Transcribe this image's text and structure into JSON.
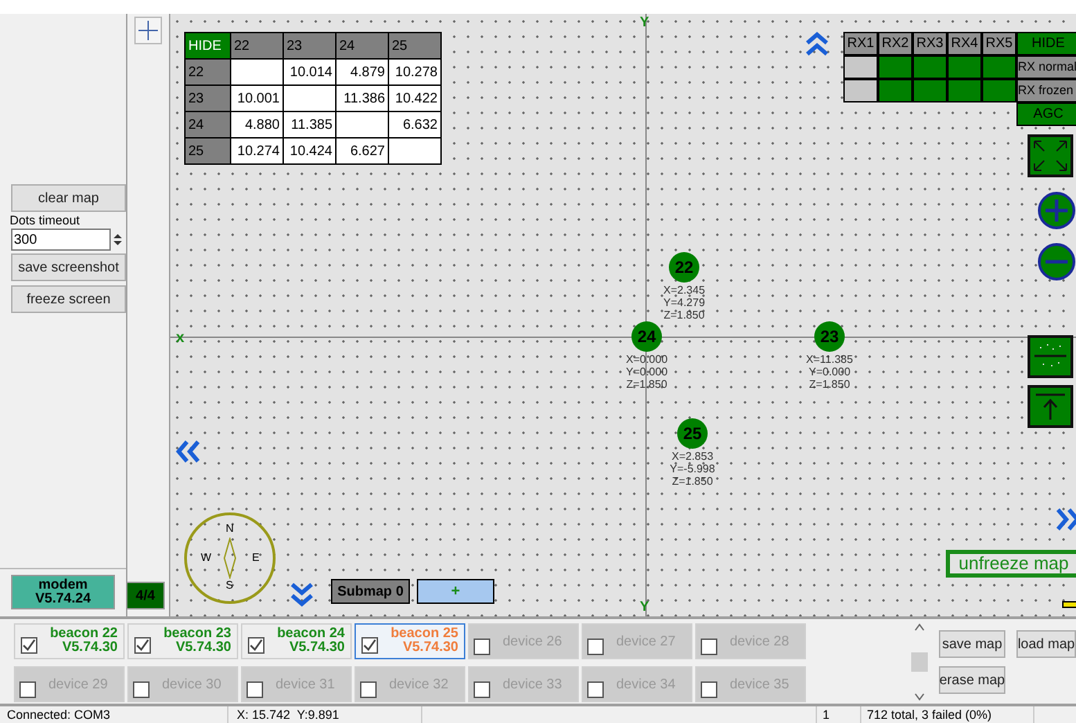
{
  "left_panel": {
    "clear_button": "clear map",
    "dots_timeout": {
      "label": "Dots timeout",
      "value": "300"
    },
    "screenshot_button": "save screenshot",
    "freeze_button": "freeze screen",
    "modem": {
      "name": "modem",
      "version": "V5.74.24"
    },
    "count": "4/4"
  },
  "distance_table": {
    "hide_label": "HIDE",
    "columns": [
      "22",
      "23",
      "24",
      "25"
    ],
    "rows": [
      {
        "label": "22",
        "cells": [
          null,
          "10.014",
          "4.879",
          "10.278"
        ]
      },
      {
        "label": "23",
        "cells": [
          "10.001",
          null,
          "11.386",
          "10.422"
        ]
      },
      {
        "label": "24",
        "cells": [
          "4.880",
          "11.385",
          null,
          "6.632"
        ]
      },
      {
        "label": "25",
        "cells": [
          "10.274",
          "10.424",
          "6.627",
          null
        ]
      }
    ]
  },
  "rx_table": {
    "columns": [
      "RX1",
      "RX2",
      "RX3",
      "RX4",
      "RX5"
    ],
    "hide_label": "HIDE",
    "rows": [
      {
        "label": "RX normal",
        "cells": [
          {
            "on": false
          },
          {
            "on": true
          },
          {
            "on": true
          },
          {
            "on": true
          },
          {
            "on": true
          }
        ]
      },
      {
        "label": "RX frozen",
        "cells": [
          {
            "on": false
          },
          {
            "on": true
          },
          {
            "on": true
          },
          {
            "on": true
          },
          {
            "on": true
          }
        ]
      }
    ],
    "agc_label": "AGC"
  },
  "axes": {
    "x_label": "x",
    "y_label_top": "Y",
    "y_label_bottom": "Y"
  },
  "compass": {
    "north": "N",
    "east": "E",
    "south": "S",
    "west": "W"
  },
  "nodes": [
    {
      "label": "22",
      "coords": [
        "X=2.345",
        "Y=4.279",
        "Z=1.850"
      ]
    },
    {
      "label": "24",
      "coords": [
        "X=0.000",
        "Y=0.000",
        "Z=1.850"
      ]
    },
    {
      "label": "23",
      "coords": [
        "X=11.385",
        "Y=0.000",
        "Z=1.850"
      ]
    },
    {
      "label": "25",
      "coords": [
        "X=2.853",
        "Y=-5.998",
        "Z=1.850"
      ]
    }
  ],
  "submap_button": "Submap 0",
  "add_submap_button": "+",
  "unfreeze_button": "unfreeze map",
  "devices": [
    {
      "kind": "beacon",
      "name": "beacon 22",
      "version": "V5.74.30",
      "checked": true,
      "selected": false,
      "color": "#1a8c1a"
    },
    {
      "kind": "beacon",
      "name": "beacon 23",
      "version": "V5.74.30",
      "checked": true,
      "selected": false,
      "color": "#1a8c1a"
    },
    {
      "kind": "beacon",
      "name": "beacon 24",
      "version": "V5.74.30",
      "checked": true,
      "selected": false,
      "color": "#1a8c1a"
    },
    {
      "kind": "beacon",
      "name": "beacon 25",
      "version": "V5.74.30",
      "checked": true,
      "selected": true,
      "color": "#f07d3c"
    },
    {
      "kind": "device",
      "name": "device 26",
      "checked": false,
      "selected": false
    },
    {
      "kind": "device",
      "name": "device 27",
      "checked": false,
      "selected": false
    },
    {
      "kind": "device",
      "name": "device 28",
      "checked": false,
      "selected": false
    },
    {
      "kind": "device",
      "name": "device 29",
      "checked": false,
      "selected": false
    },
    {
      "kind": "device",
      "name": "device 30",
      "checked": false,
      "selected": false
    },
    {
      "kind": "device",
      "name": "device 31",
      "checked": false,
      "selected": false
    },
    {
      "kind": "device",
      "name": "device 32",
      "checked": false,
      "selected": false
    },
    {
      "kind": "device",
      "name": "device 33",
      "checked": false,
      "selected": false
    },
    {
      "kind": "device",
      "name": "device 34",
      "checked": false,
      "selected": false
    },
    {
      "kind": "device",
      "name": "device 35",
      "checked": false,
      "selected": false
    }
  ],
  "map_buttons": [
    "save map",
    "erase map",
    "load map"
  ],
  "status_bar": {
    "connection": "Connected: COM3",
    "cursor": "X: 15.742  Y:9.891",
    "counter": "1",
    "stats": "712 total, 3 failed (0%)"
  }
}
